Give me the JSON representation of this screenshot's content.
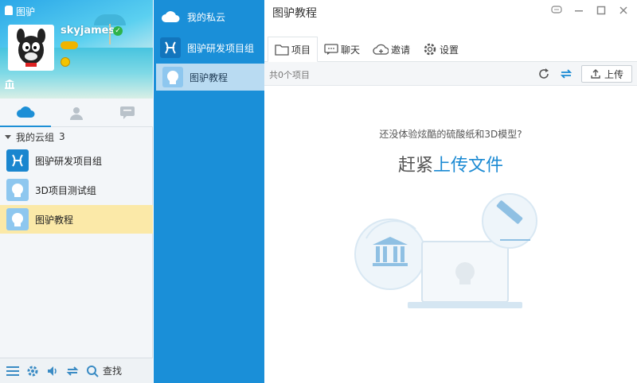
{
  "app": {
    "title": "图驴"
  },
  "profile": {
    "username": "skyjames"
  },
  "left_tabs": [
    "cloud",
    "contacts",
    "messages"
  ],
  "group_section": {
    "label": "我的云组",
    "count": "3"
  },
  "groups": [
    {
      "name": "图驴研发项目组",
      "icon": "pisces-icon"
    },
    {
      "name": "3D项目测试组",
      "icon": "head-avatar-icon"
    },
    {
      "name": "图驴教程",
      "icon": "head-avatar-icon"
    }
  ],
  "bottom_bar": {
    "search_label": "查找"
  },
  "middle": {
    "items": [
      {
        "label": "我的私云",
        "icon": "cloud-icon"
      },
      {
        "label": "图驴研发项目组",
        "icon": "pisces-icon"
      },
      {
        "label": "图驴教程",
        "icon": "head-avatar-icon"
      }
    ]
  },
  "right": {
    "title": "图驴教程",
    "tabs": [
      {
        "label": "项目",
        "icon": "folder-icon"
      },
      {
        "label": "聊天",
        "icon": "chat-icon"
      },
      {
        "label": "邀请",
        "icon": "cloud-invite-icon"
      },
      {
        "label": "设置",
        "icon": "gear-icon"
      }
    ],
    "item_count": "共0个项目",
    "upload_label": "上传",
    "empty_question": "还没体验炫酷的硫酸纸和3D模型?",
    "cta_prefix": "赶紧",
    "cta_link": "上传文件"
  },
  "colors": {
    "accent": "#1a8fd8",
    "selected_row": "#fbe9a8",
    "link": "#1b8ad3"
  }
}
